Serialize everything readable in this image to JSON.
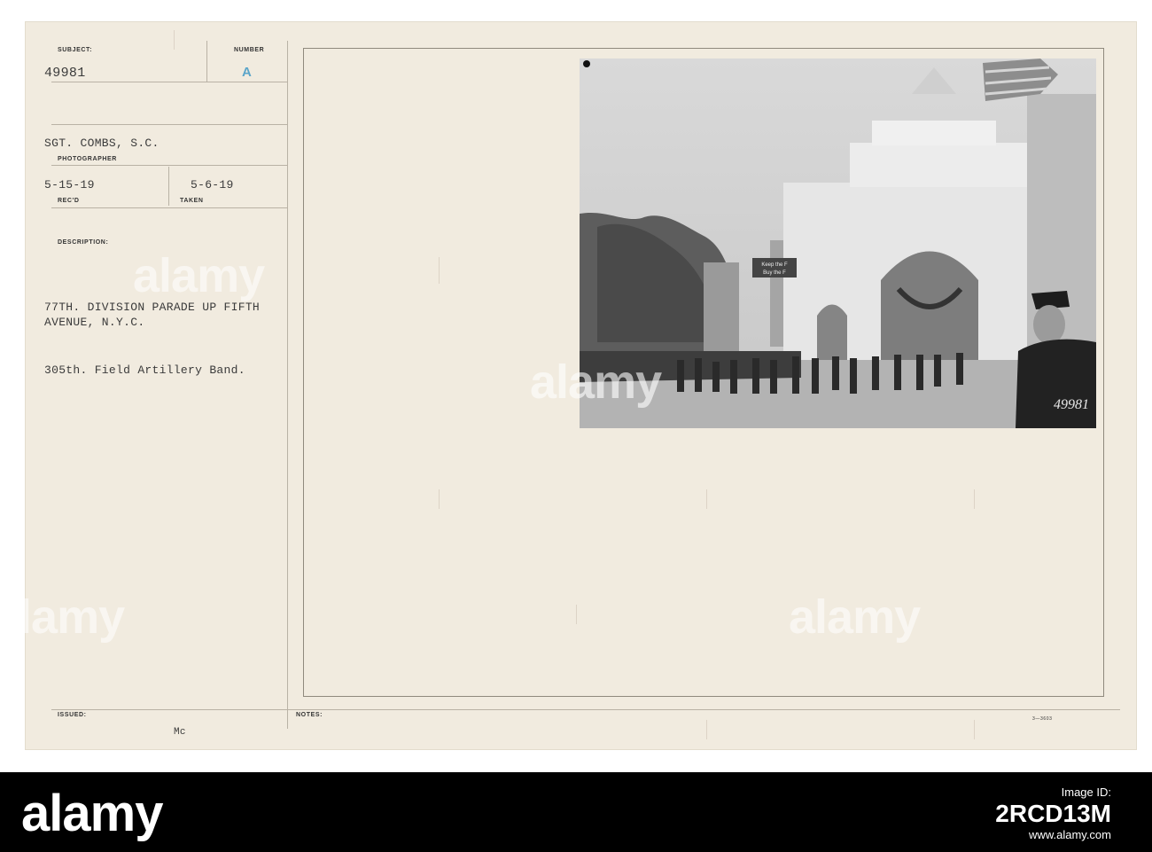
{
  "card": {
    "subject_label": "SUBJECT:",
    "subject_value": "49981",
    "number_label": "NUMBER",
    "number_value": "A",
    "photographer_value": "SGT. COMBS, S.C.",
    "photographer_label": "PHOTOGRAPHER",
    "recd_value": "5-15-19",
    "recd_label": "REC'D",
    "taken_value": "5-6-19",
    "taken_label": "TAKEN",
    "description_label": "DESCRIPTION:",
    "description_line1": "77TH. DIVISION PARADE UP FIFTH",
    "description_line2": "AVENUE, N.Y.C.",
    "description_line3": "305th. Field Artillery Band.",
    "issued_label": "ISSUED:",
    "issued_mark": "Mc",
    "notes_label": "NOTES:",
    "form_number": "3—3603"
  },
  "photo": {
    "sign_line1": "Keep the F",
    "sign_line2": "Buy the F",
    "negative_number": "49981"
  },
  "watermark": {
    "text": "alamy"
  },
  "footer": {
    "logo": "alamy",
    "image_id_label": "Image ID:",
    "image_id": "2RCD13M",
    "site": "www.alamy.com"
  }
}
